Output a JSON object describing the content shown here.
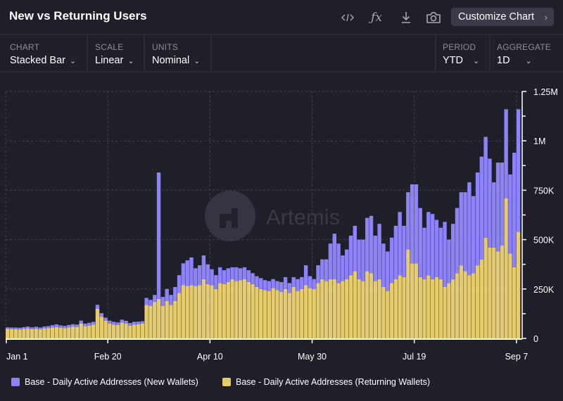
{
  "header": {
    "title": "New vs Returning Users",
    "customize_label": "Customize Chart",
    "icons": [
      "code-icon",
      "function-icon",
      "download-icon",
      "camera-icon"
    ]
  },
  "controls": {
    "chart": {
      "label": "CHART",
      "value": "Stacked Bar"
    },
    "scale": {
      "label": "SCALE",
      "value": "Linear"
    },
    "units": {
      "label": "UNITS",
      "value": "Nominal"
    },
    "period": {
      "label": "PERIOD",
      "value": "YTD"
    },
    "aggregate": {
      "label": "AGGREGATE",
      "value": "1D"
    }
  },
  "watermark": "Artemis",
  "colors": {
    "new": "#8b83f7",
    "returning": "#e6cc6e",
    "background": "#1f1f2a"
  },
  "chart_data": {
    "type": "bar",
    "stacked": true,
    "title": "",
    "y_ticks": [
      "0",
      "250K",
      "500K",
      "750K",
      "1M",
      "1.25M"
    ],
    "ylim": [
      0,
      1250000
    ],
    "y_unit": "K",
    "x_ticks": [
      "Jan 1",
      "Feb 20",
      "Apr 10",
      "May 30",
      "Jul 19",
      "Sep 7"
    ],
    "grid": true,
    "legend_position": "bottom",
    "y_axis_position": "right",
    "dates": [
      "Jan 1",
      "Jan 3",
      "Jan 5",
      "Jan 7",
      "Jan 9",
      "Jan 11",
      "Jan 13",
      "Jan 15",
      "Jan 17",
      "Jan 19",
      "Jan 21",
      "Jan 23",
      "Jan 25",
      "Jan 27",
      "Jan 29",
      "Jan 31",
      "Feb 2",
      "Feb 4",
      "Feb 6",
      "Feb 8",
      "Feb 10",
      "Feb 12",
      "Feb 14",
      "Feb 16",
      "Feb 18",
      "Feb 20",
      "Feb 22",
      "Feb 24",
      "Feb 26",
      "Feb 28",
      "Mar 1",
      "Mar 3",
      "Mar 5",
      "Mar 7",
      "Mar 9",
      "Mar 11",
      "Mar 13",
      "Mar 15",
      "Mar 17",
      "Mar 19",
      "Mar 21",
      "Mar 23",
      "Mar 25",
      "Mar 27",
      "Mar 29",
      "Mar 31",
      "Apr 2",
      "Apr 4",
      "Apr 6",
      "Apr 8",
      "Apr 10",
      "Apr 12",
      "Apr 14",
      "Apr 16",
      "Apr 18",
      "Apr 20",
      "Apr 22",
      "Apr 24",
      "Apr 26",
      "Apr 28",
      "Apr 30",
      "May 2",
      "May 4",
      "May 6",
      "May 8",
      "May 10",
      "May 12",
      "May 14",
      "May 16",
      "May 18",
      "May 20",
      "May 22",
      "May 24",
      "May 26",
      "May 28",
      "May 30",
      "Jun 1",
      "Jun 3",
      "Jun 5",
      "Jun 7",
      "Jun 9",
      "Jun 11",
      "Jun 13",
      "Jun 15",
      "Jun 17",
      "Jun 19",
      "Jun 21",
      "Jun 23",
      "Jun 25",
      "Jun 27",
      "Jun 29",
      "Jul 1",
      "Jul 3",
      "Jul 5",
      "Jul 7",
      "Jul 9",
      "Jul 11",
      "Jul 13",
      "Jul 15",
      "Jul 17",
      "Jul 19",
      "Jul 21",
      "Jul 23",
      "Jul 25",
      "Jul 27",
      "Jul 29",
      "Jul 31",
      "Aug 2",
      "Aug 4",
      "Aug 6",
      "Aug 8",
      "Aug 10",
      "Aug 12",
      "Aug 14",
      "Aug 16",
      "Aug 18",
      "Aug 20",
      "Aug 22",
      "Aug 24",
      "Aug 26",
      "Aug 28",
      "Aug 30",
      "Sep 1",
      "Sep 3",
      "Sep 5",
      "Sep 7"
    ],
    "series": [
      {
        "name": "Base - Daily Active Addresses (New Wallets)",
        "color": "#8b83f7",
        "values_k": [
          8,
          9,
          8,
          9,
          9,
          10,
          9,
          10,
          9,
          10,
          10,
          12,
          13,
          12,
          11,
          12,
          12,
          12,
          15,
          13,
          14,
          14,
          20,
          18,
          15,
          15,
          14,
          13,
          15,
          14,
          13,
          14,
          13,
          12,
          35,
          30,
          35,
          640,
          45,
          60,
          50,
          70,
          90,
          110,
          130,
          140,
          90,
          100,
          120,
          100,
          80,
          70,
          80,
          70,
          70,
          60,
          70,
          60,
          60,
          60,
          55,
          55,
          55,
          50,
          50,
          45,
          45,
          50,
          60,
          50,
          50,
          60,
          60,
          100,
          60,
          50,
          90,
          100,
          110,
          180,
          230,
          200,
          130,
          150,
          200,
          230,
          200,
          210,
          270,
          290,
          230,
          280,
          220,
          200,
          230,
          270,
          320,
          260,
          290,
          400,
          400,
          350,
          260,
          320,
          330,
          290,
          260,
          330,
          220,
          280,
          330,
          370,
          400,
          470,
          390,
          470,
          520,
          510,
          450,
          330,
          450,
          420,
          450,
          400,
          580,
          620
        ]
      },
      {
        "name": "Base - Daily Active Addresses (Returning Wallets)",
        "color": "#e6cc6e",
        "values_k": [
          48,
          46,
          47,
          45,
          48,
          50,
          47,
          49,
          46,
          50,
          52,
          55,
          58,
          54,
          52,
          56,
          60,
          58,
          75,
          62,
          65,
          70,
          150,
          110,
          90,
          75,
          70,
          68,
          80,
          75,
          65,
          70,
          72,
          75,
          170,
          165,
          185,
          200,
          165,
          190,
          170,
          190,
          230,
          270,
          265,
          270,
          265,
          270,
          300,
          275,
          270,
          250,
          280,
          275,
          285,
          300,
          290,
          295,
          300,
          285,
          275,
          260,
          250,
          245,
          240,
          255,
          245,
          235,
          250,
          230,
          260,
          240,
          250,
          270,
          255,
          250,
          280,
          300,
          290,
          300,
          300,
          280,
          290,
          300,
          320,
          340,
          300,
          290,
          340,
          330,
          290,
          300,
          260,
          240,
          280,
          300,
          320,
          310,
          450,
          380,
          380,
          310,
          300,
          320,
          300,
          310,
          300,
          260,
          280,
          300,
          330,
          370,
          340,
          320,
          330,
          370,
          400,
          510,
          460,
          460,
          440,
          470,
          710,
          430,
          360,
          540
        ]
      }
    ]
  }
}
